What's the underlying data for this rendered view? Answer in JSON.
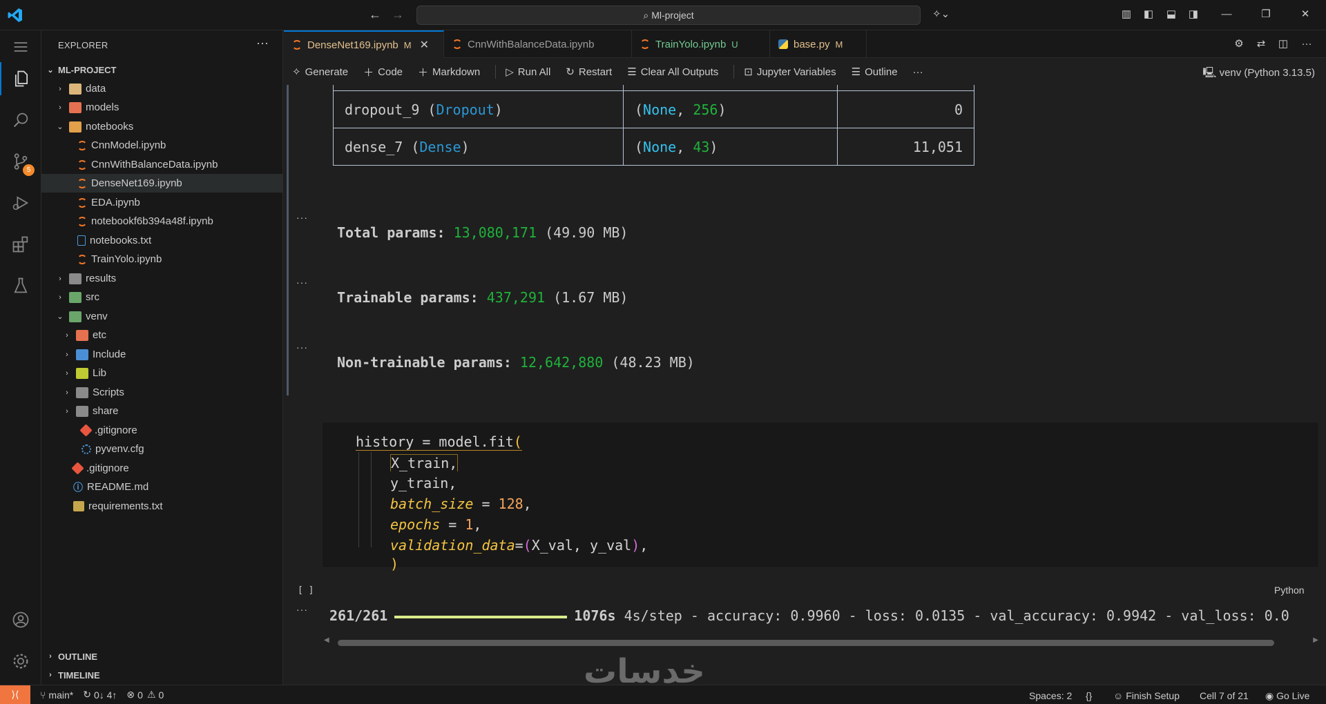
{
  "titlebar": {
    "search": "Ml-project"
  },
  "activity": {
    "scm_badge": "5"
  },
  "sidebar": {
    "title": "EXPLORER",
    "more": "···",
    "project": "ML-PROJECT",
    "tree": [
      {
        "label": "data",
        "icon": "folder"
      },
      {
        "label": "models",
        "icon": "folder-red"
      },
      {
        "label": "notebooks",
        "icon": "folder-open"
      },
      {
        "label": "CnnModel.ipynb",
        "icon": "notebook"
      },
      {
        "label": "CnnWithBalanceData.ipynb",
        "icon": "notebook"
      },
      {
        "label": "DenseNet169.ipynb",
        "icon": "notebook"
      },
      {
        "label": "EDA.ipynb",
        "icon": "notebook"
      },
      {
        "label": "notebookf6b394a48f.ipynb",
        "icon": "notebook"
      },
      {
        "label": "notebooks.txt",
        "icon": "text-file"
      },
      {
        "label": "TrainYolo.ipynb",
        "icon": "notebook"
      },
      {
        "label": "results",
        "icon": "folder"
      },
      {
        "label": "src",
        "icon": "folder-src"
      },
      {
        "label": "venv",
        "icon": "folder-open"
      },
      {
        "label": "etc",
        "icon": "folder"
      },
      {
        "label": "Include",
        "icon": "folder"
      },
      {
        "label": "Lib",
        "icon": "folder"
      },
      {
        "label": "Scripts",
        "icon": "folder"
      },
      {
        "label": "share",
        "icon": "folder"
      },
      {
        "label": ".gitignore",
        "icon": "git"
      },
      {
        "label": "pyvenv.cfg",
        "icon": "config"
      },
      {
        "label": ".gitignore",
        "icon": "git"
      },
      {
        "label": "README.md",
        "icon": "markdown"
      },
      {
        "label": "requirements.txt",
        "icon": "requirements"
      }
    ],
    "outline": "OUTLINE",
    "timeline": "TIMELINE"
  },
  "tabs": [
    {
      "label": "DenseNet169.ipynb",
      "mark": "M"
    },
    {
      "label": "CnnWithBalanceData.ipynb",
      "mark": ""
    },
    {
      "label": "TrainYolo.ipynb",
      "mark": "U"
    },
    {
      "label": "base.py",
      "mark": "M"
    }
  ],
  "toolbar": {
    "generate": "Generate",
    "code": "Code",
    "markdown": "Markdown",
    "run_all": "Run All",
    "restart": "Restart",
    "clear": "Clear All Outputs",
    "variables": "Jupyter Variables",
    "outline": "Outline",
    "more": "···",
    "kernel": "venv (Python 3.13.5)"
  },
  "summary_rows": [
    {
      "name": "dropout_9",
      "type": "Dropout",
      "none": "None",
      "shape": "256",
      "params": "0"
    },
    {
      "name": "dense_7",
      "type": "Dense",
      "none": "None",
      "shape": "43",
      "params": "11,051"
    }
  ],
  "params": {
    "total_label": "Total params:",
    "total_value": "13,080,171",
    "total_size": "(49.90 MB)",
    "trainable_label": "Trainable params:",
    "trainable_value": "437,291",
    "trainable_size": "(1.67 MB)",
    "nontrainable_label": "Non-trainable params:",
    "nontrainable_value": "12,642,880",
    "nontrainable_size": "(48.23 MB)"
  },
  "code": {
    "l1": "history = model.fit",
    "l2": "X_train,",
    "l3": "y_train,",
    "l4_kw": "batch_size",
    "l4_num": "128",
    "l5_kw": "epochs",
    "l5_num": "1",
    "l6_kw": "validation_data",
    "l6_args": "X_val, y_val",
    "exec": "[ ]",
    "language": "Python"
  },
  "output": {
    "steps": "261/261",
    "time": "1076s",
    "rest": "4s/step - accuracy: 0.9960 - loss: 0.0135 - val_accuracy: 0.9942 - val_loss: 0.0",
    "progress": 1.0
  },
  "watermark": "خدسات",
  "statusbar": {
    "branch": "main*",
    "sync": "0↓ 4↑",
    "errors": "0",
    "warnings": "0",
    "spaces": "Spaces: 2",
    "braces": "{}",
    "finish": "Finish Setup",
    "cell": "Cell 7 of 21",
    "golive": "Go Live"
  }
}
